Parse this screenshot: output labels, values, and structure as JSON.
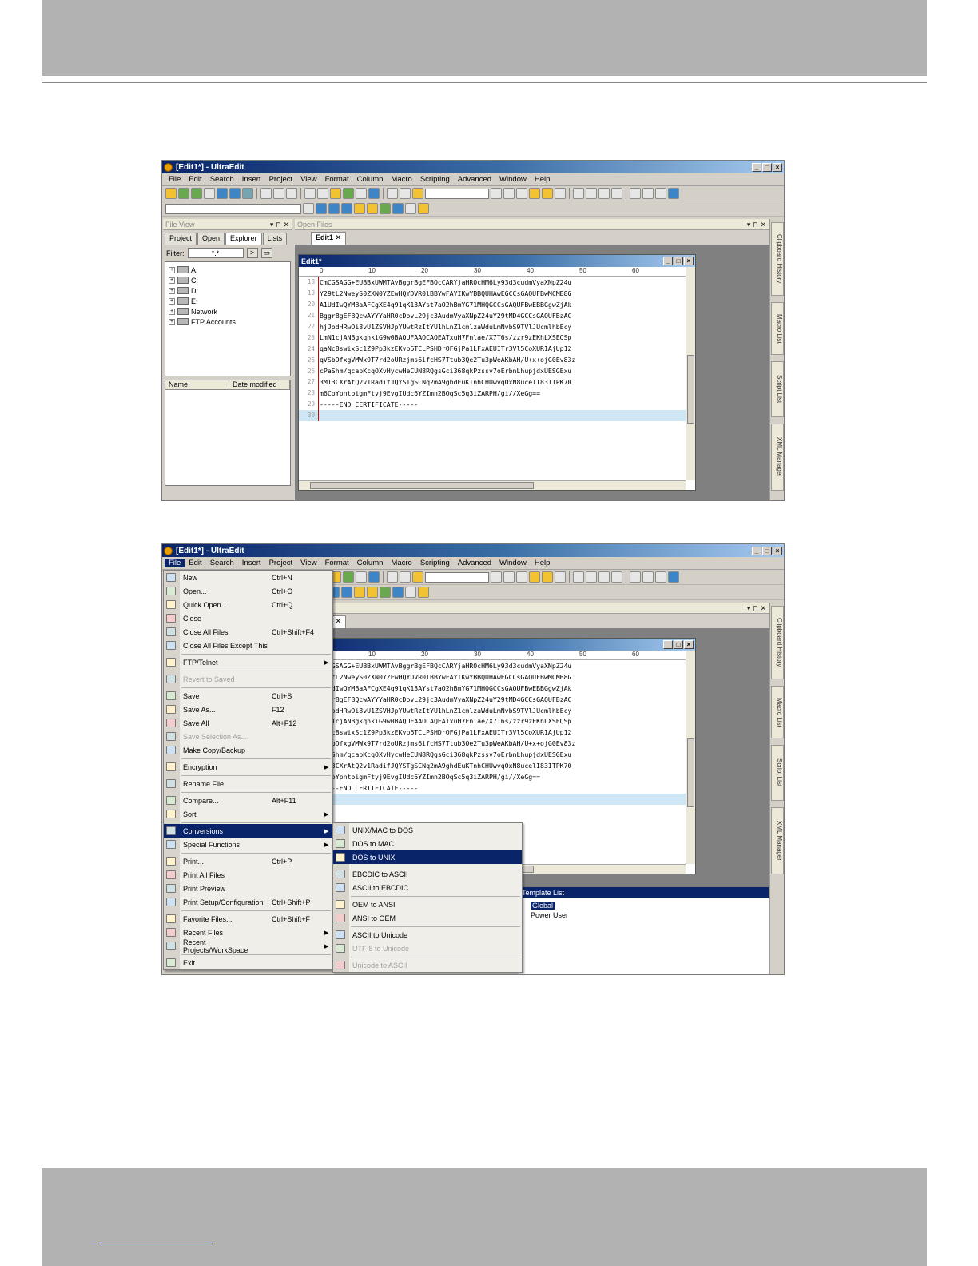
{
  "app": {
    "title": "[Edit1*] - UltraEdit",
    "caption_buttons": [
      "_",
      "□",
      "×"
    ]
  },
  "menubar": [
    "File",
    "Edit",
    "Search",
    "Insert",
    "Project",
    "View",
    "Format",
    "Column",
    "Macro",
    "Scripting",
    "Advanced",
    "Window",
    "Help"
  ],
  "file_view": {
    "title": "File View",
    "tabs": [
      "Project",
      "Open",
      "Explorer",
      "Lists"
    ],
    "filter_label": "Filter:",
    "filter_value": "*.*",
    "go_button": ">",
    "tree": [
      "A:",
      "C:",
      "D:",
      "E:",
      "Network",
      "FTP Accounts"
    ],
    "list_columns": [
      "Name",
      "Date modified"
    ]
  },
  "open_files": {
    "title": "Open Files",
    "tab": "Edit1"
  },
  "document": {
    "title": "Edit1*",
    "ruler": [
      "0",
      "10",
      "20",
      "30",
      "40",
      "50",
      "60"
    ],
    "lines": [
      {
        "n": "18",
        "t": "CmCGSAGG+EUBBxUWMTAvBggrBgEFBQcCARYjaHR0cHM6Ly93d3cudmVyaXNpZ24u"
      },
      {
        "n": "19",
        "t": "Y29tL2NweyS0ZXN0YZEwHQYDVR0lBBYwFAYIKwYBBQUHAwEGCCsGAQUFBwMCMB8G"
      },
      {
        "n": "20",
        "t": "A1UdIwQYMBaAFCgXE4q91qK13AYst7aO2hBmYG71MHQGCCsGAQUFBwEBBGgwZjAk"
      },
      {
        "n": "21",
        "t": "BggrBgEFBQcwAYYYaHR0cDovL29jc3AudmVyaXNpZ24uY29tMD4GCCsGAQUFBzAC"
      },
      {
        "n": "22",
        "t": "hjJodHRwOi8vU1ZSVHJpYUwtRzItYU1hLnZ1cmlzaWduLmNvbS9TVlJUcmlhbEcy"
      },
      {
        "n": "23",
        "t": "LmN1cjANBgkqhkiG9w0BAQUFAAOCAQEATxuH7Fnlae/X7T6s/zzr9zEKhLXSEQSp"
      },
      {
        "n": "24",
        "t": "qaNc8swixSc1Z9Pp3kzEKvp6TCLPSHDrOFGjPa1LFxAEUITr3Vl5CoXUR1AjUp12"
      },
      {
        "n": "25",
        "t": "qVSbDfxgVMWx9T7rd2oURzjms6ifcHS7Ttub3Qe2Tu3pWeAKbAH/U+x+ojG0Ev83z"
      },
      {
        "n": "26",
        "t": "cPaShm/qcapKcqOXvHycwHeCUN8RQgsGci368qkPzssv7oErbnLhupjdxUESGExu"
      },
      {
        "n": "27",
        "t": "3M13CXrAtQ2v1RadifJQYSTgSCNq2mA9ghdEuKTnhCHUwvqOxN8ucelI83ITPK70"
      },
      {
        "n": "28",
        "t": "m6CoYpntbigmFtyj9EvgIUdc6YZImn2BOqSc5q3iZARPH/gi//XeGg=="
      },
      {
        "n": "29",
        "t": "-----END CERTIFICATE-----"
      },
      {
        "n": "30",
        "t": ""
      }
    ]
  },
  "side_tabs": [
    "Clipboard History",
    "Macro List",
    "Script List",
    "XML Manager"
  ],
  "file_menu": [
    {
      "label": "New",
      "shortcut": "Ctrl+N"
    },
    {
      "label": "Open...",
      "shortcut": "Ctrl+O"
    },
    {
      "label": "Quick Open...",
      "shortcut": "Ctrl+Q"
    },
    {
      "label": "Close",
      "shortcut": ""
    },
    {
      "label": "Close All Files",
      "shortcut": "Ctrl+Shift+F4"
    },
    {
      "label": "Close All Files Except This",
      "shortcut": ""
    },
    {
      "sep": true
    },
    {
      "label": "FTP/Telnet",
      "shortcut": "",
      "sub": true
    },
    {
      "sep": true
    },
    {
      "label": "Revert to Saved",
      "shortcut": "",
      "disabled": true
    },
    {
      "sep": true
    },
    {
      "label": "Save",
      "shortcut": "Ctrl+S"
    },
    {
      "label": "Save As...",
      "shortcut": "F12"
    },
    {
      "label": "Save All",
      "shortcut": "Alt+F12"
    },
    {
      "label": "Save Selection As...",
      "shortcut": "",
      "disabled": true
    },
    {
      "label": "Make Copy/Backup",
      "shortcut": ""
    },
    {
      "sep": true
    },
    {
      "label": "Encryption",
      "shortcut": "",
      "sub": true
    },
    {
      "sep": true
    },
    {
      "label": "Rename File",
      "shortcut": ""
    },
    {
      "sep": true
    },
    {
      "label": "Compare...",
      "shortcut": "Alt+F11"
    },
    {
      "label": "Sort",
      "shortcut": "",
      "sub": true
    },
    {
      "sep": true
    },
    {
      "label": "Conversions",
      "shortcut": "",
      "sub": true,
      "highlight": true
    },
    {
      "label": "Special Functions",
      "shortcut": "",
      "sub": true
    },
    {
      "sep": true
    },
    {
      "label": "Print...",
      "shortcut": "Ctrl+P"
    },
    {
      "label": "Print All Files",
      "shortcut": ""
    },
    {
      "label": "Print Preview",
      "shortcut": ""
    },
    {
      "label": "Print Setup/Configuration",
      "shortcut": "Ctrl+Shift+P"
    },
    {
      "sep": true
    },
    {
      "label": "Favorite Files...",
      "shortcut": "Ctrl+Shift+F"
    },
    {
      "label": "Recent Files",
      "shortcut": "",
      "sub": true
    },
    {
      "label": "Recent Projects/WorkSpace",
      "shortcut": "",
      "sub": true
    },
    {
      "sep": true
    },
    {
      "label": "Exit",
      "shortcut": ""
    }
  ],
  "conversions_menu": [
    {
      "label": "UNIX/MAC to DOS"
    },
    {
      "label": "DOS to MAC"
    },
    {
      "label": "DOS to UNIX",
      "highlight": true
    },
    {
      "sep": true
    },
    {
      "label": "EBCDIC to ASCII"
    },
    {
      "label": "ASCII to EBCDIC"
    },
    {
      "sep": true
    },
    {
      "label": "OEM to ANSI"
    },
    {
      "label": "ANSI to OEM"
    },
    {
      "sep": true
    },
    {
      "label": "ASCII to Unicode"
    },
    {
      "label": "UTF-8 to Unicode",
      "disabled": true
    },
    {
      "sep": true
    },
    {
      "label": "Unicode to ASCII",
      "disabled": true
    }
  ],
  "template_list": {
    "title": "Template List",
    "items": [
      "Global",
      "Power User"
    ]
  },
  "colors": {
    "title_gradient_start": "#0a246a",
    "highlight": "#0a246a",
    "current_line": "#cfe6f5",
    "gutter_marker": "#cc0000"
  }
}
